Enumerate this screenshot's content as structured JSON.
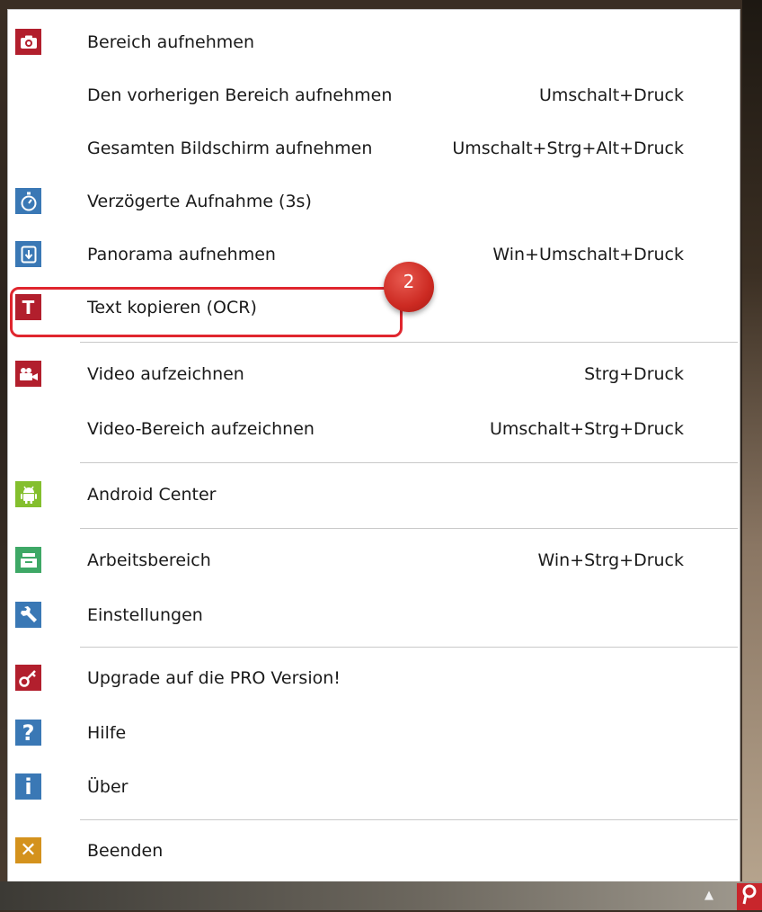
{
  "menu": {
    "items": [
      {
        "label": "Bereich aufnehmen",
        "shortcut": "",
        "icon": "camera-icon",
        "icon_color": "#b21f2d"
      },
      {
        "label": "Den vorherigen Bereich aufnehmen",
        "shortcut": "Umschalt+Druck",
        "icon": "",
        "icon_color": ""
      },
      {
        "label": "Gesamten Bildschirm aufnehmen",
        "shortcut": "Umschalt+Strg+Alt+Druck",
        "icon": "",
        "icon_color": ""
      },
      {
        "label": "Verzögerte Aufnahme (3s)",
        "shortcut": "",
        "icon": "stopwatch-icon",
        "icon_color": "#3a78b5"
      },
      {
        "label": "Panorama aufnehmen",
        "shortcut": "Win+Umschalt+Druck",
        "icon": "panorama-scroll-icon",
        "icon_color": "#3a78b5"
      },
      {
        "label": "Text kopieren (OCR)",
        "shortcut": "",
        "icon": "text-t-icon",
        "icon_color": "#b21f2d"
      },
      {
        "label": "Video aufzeichnen",
        "shortcut": "Strg+Druck",
        "icon": "video-camera-icon",
        "icon_color": "#b21f2d"
      },
      {
        "label": "Video-Bereich aufzeichnen",
        "shortcut": "Umschalt+Strg+Druck",
        "icon": "",
        "icon_color": ""
      },
      {
        "label": "Android Center",
        "shortcut": "",
        "icon": "android-icon",
        "icon_color": "#84bf2e"
      },
      {
        "label": "Arbeitsbereich",
        "shortcut": "Win+Strg+Druck",
        "icon": "workspace-tray-icon",
        "icon_color": "#3ea866"
      },
      {
        "label": "Einstellungen",
        "shortcut": "",
        "icon": "wrench-icon",
        "icon_color": "#3a78b5"
      },
      {
        "label": "Upgrade auf die PRO Version!",
        "shortcut": "",
        "icon": "key-icon",
        "icon_color": "#b21f2d"
      },
      {
        "label": "Hilfe",
        "shortcut": "",
        "icon": "question-icon",
        "icon_color": "#3a78b5"
      },
      {
        "label": "Über",
        "shortcut": "",
        "icon": "info-icon",
        "icon_color": "#3a78b5"
      },
      {
        "label": "Beenden",
        "shortcut": "",
        "icon": "close-x-icon",
        "icon_color": "#d4921d"
      }
    ]
  },
  "annotation": {
    "badge_number": "2",
    "highlight_color": "#e0262e"
  },
  "taskbar": {
    "tray_icon": "picpick-logo-icon",
    "tray_arrow_icon": "tray-up-arrow-icon"
  }
}
